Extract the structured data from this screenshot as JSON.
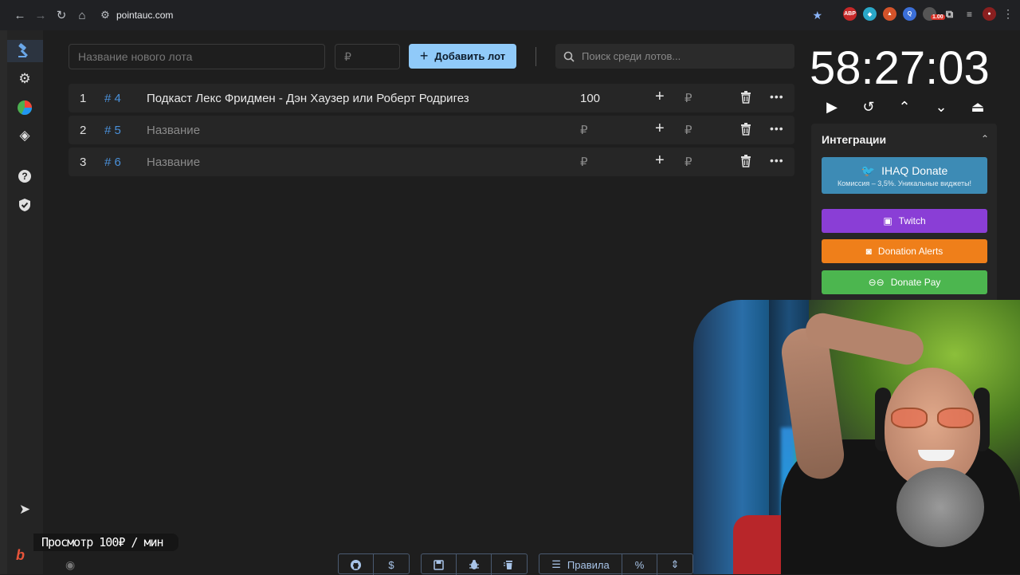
{
  "browser": {
    "url": "pointauc.com",
    "ext_badge": "1.00"
  },
  "toolbar": {
    "new_lot_placeholder": "Название нового лота",
    "amount_placeholder": "₽",
    "add_label": "Добавить лот",
    "search_placeholder": "Поиск среди лотов..."
  },
  "lots": [
    {
      "index": "1",
      "id": "# 4",
      "name": "Подкаст Лекс Фридмен - Дэн Хаузер или Роберт Родригез",
      "amount": "100",
      "currency": "₽"
    },
    {
      "index": "2",
      "id": "# 5",
      "name": "Название",
      "amount": "₽",
      "currency": "₽"
    },
    {
      "index": "3",
      "id": "# 6",
      "name": "Название",
      "amount": "₽",
      "currency": "₽"
    }
  ],
  "timer": "58:27:03",
  "integrations": {
    "title": "Интеграции",
    "ihaq_label": "IHAQ Donate",
    "ihaq_sub": "Комиссия – 3,5%. Уникальные виджеты!",
    "twitch_label": "Twitch",
    "da_label": "Donation Alerts",
    "dp_label": "Donate Pay"
  },
  "bottom": {
    "rules_label": "Правила",
    "percent_label": "%",
    "dollar_label": "$"
  },
  "overlay": {
    "text": "Просмотр 100₽ / мин"
  },
  "colors": {
    "accent": "#90caf9",
    "twitch": "#8a3ed6",
    "donation_alerts": "#ef7f1a",
    "donate_pay": "#4cb64f",
    "ihaq": "#3d8bb5"
  }
}
